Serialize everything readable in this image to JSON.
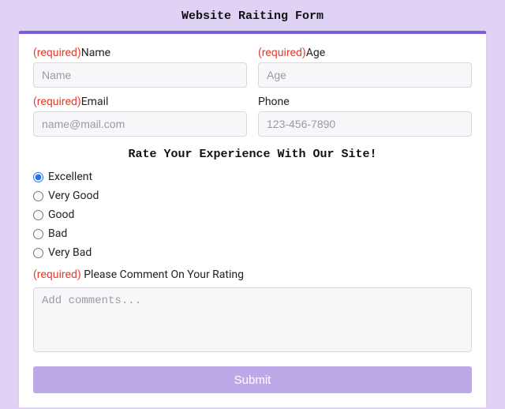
{
  "title": "Website Raiting Form",
  "required_marker": "(required)",
  "fields": {
    "name": {
      "label": "Name",
      "placeholder": "Name",
      "required": true
    },
    "age": {
      "label": "Age",
      "placeholder": "Age",
      "required": true
    },
    "email": {
      "label": "Email",
      "placeholder": "name@mail.com",
      "required": true
    },
    "phone": {
      "label": "Phone",
      "placeholder": "123-456-7890",
      "required": false
    }
  },
  "rating": {
    "heading": "Rate Your Experience With Our Site!",
    "options": [
      "Excellent",
      "Very Good",
      "Good",
      "Bad",
      "Very Bad"
    ],
    "selected": "Excellent"
  },
  "comment": {
    "label": "Please Comment On Your Rating",
    "placeholder": "Add comments...",
    "required": true
  },
  "submit_label": "Submit"
}
